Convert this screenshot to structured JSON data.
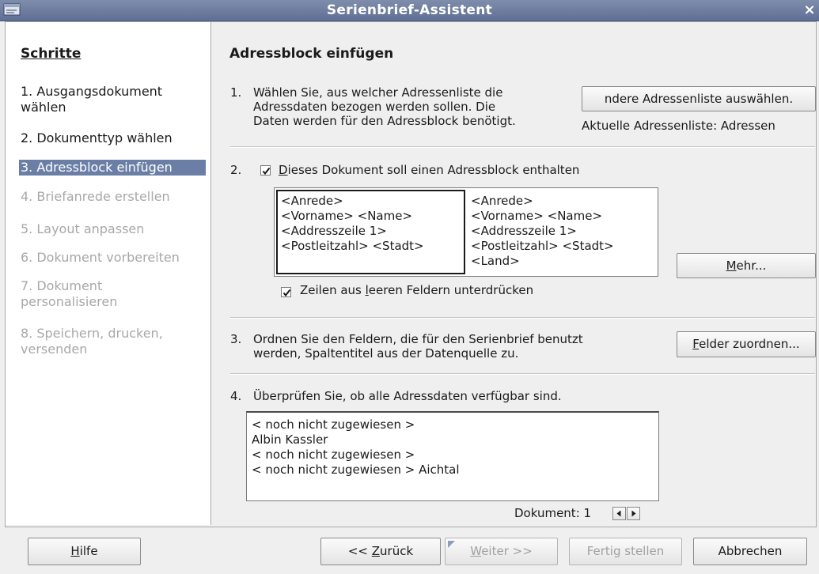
{
  "window": {
    "title": "Serienbrief-Assistent",
    "close_glyph": "×"
  },
  "sidebar": {
    "heading": "Schritte",
    "steps": [
      {
        "line1": "1. Ausgangsdokument",
        "line2": "wählen",
        "state": "done"
      },
      {
        "line1": "2. Dokumenttyp wählen",
        "line2": "",
        "state": "done"
      },
      {
        "line1": "3. Adressblock einfügen",
        "line2": "",
        "state": "active"
      },
      {
        "line1": "4. Briefanrede erstellen",
        "line2": "",
        "state": "disabled"
      },
      {
        "line1": "5. Layout anpassen",
        "line2": "",
        "state": "disabled"
      },
      {
        "line1": "6. Dokument vorbereiten",
        "line2": "",
        "state": "disabled"
      },
      {
        "line1": "7. Dokument",
        "line2": "personalisieren",
        "state": "disabled"
      },
      {
        "line1": "8. Speichern, drucken,",
        "line2": "versenden",
        "state": "disabled"
      }
    ]
  },
  "main": {
    "title": "Adressblock einfügen",
    "section1": {
      "num": "1.",
      "line1": "Wählen Sie, aus welcher Adressenliste die",
      "line2": "Adressdaten bezogen werden sollen. Die",
      "line3": "Daten werden für den Adressblock benötigt.",
      "button": "ndere Adressenliste auswählen.",
      "current_list": "Aktuelle Adressenliste: Adressen"
    },
    "section2": {
      "num": "2.",
      "checkbox_first_letter": "D",
      "checkbox_rest": "ieses Dokument soll einen Adressblock enthalten",
      "checked": true,
      "block_a": [
        "<Anrede>",
        "<Vorname> <Name>",
        "<Addresszeile 1>",
        "<Postleitzahl> <Stadt>"
      ],
      "block_b": [
        "<Anrede>",
        "<Vorname> <Name>",
        "<Addresszeile 1>",
        "<Postleitzahl> <Stadt>",
        "<Land>"
      ],
      "more_first": "M",
      "more_rest": "ehr...",
      "suppress_pre": "Zeilen aus ",
      "suppress_ul": "l",
      "suppress_post": "eeren Feldern unterdrücken",
      "suppress_checked": true
    },
    "section3": {
      "num": "3.",
      "line1": "Ordnen Sie den Feldern, die für den Serienbrief benutzt",
      "line2": "werden, Spaltentitel aus der Datenquelle zu.",
      "button_first": "F",
      "button_rest": "elder zuordnen..."
    },
    "section4": {
      "num": "4.",
      "text": "Überprüfen Sie, ob alle Adressdaten verfügbar sind.",
      "preview": [
        "< noch nicht zugewiesen >",
        "Albin Kassler",
        "< noch nicht zugewiesen >",
        "< noch nicht zugewiesen > Aichtal"
      ],
      "doc_label": "Dokument: 1"
    }
  },
  "footer": {
    "help_first": "H",
    "help_rest": "ilfe",
    "back_pre": "<< ",
    "back_first": "Z",
    "back_rest": "urück",
    "next_first": "W",
    "next_rest": "eiter >>",
    "finish": "Fertig stellen",
    "cancel": "Abbrechen"
  }
}
